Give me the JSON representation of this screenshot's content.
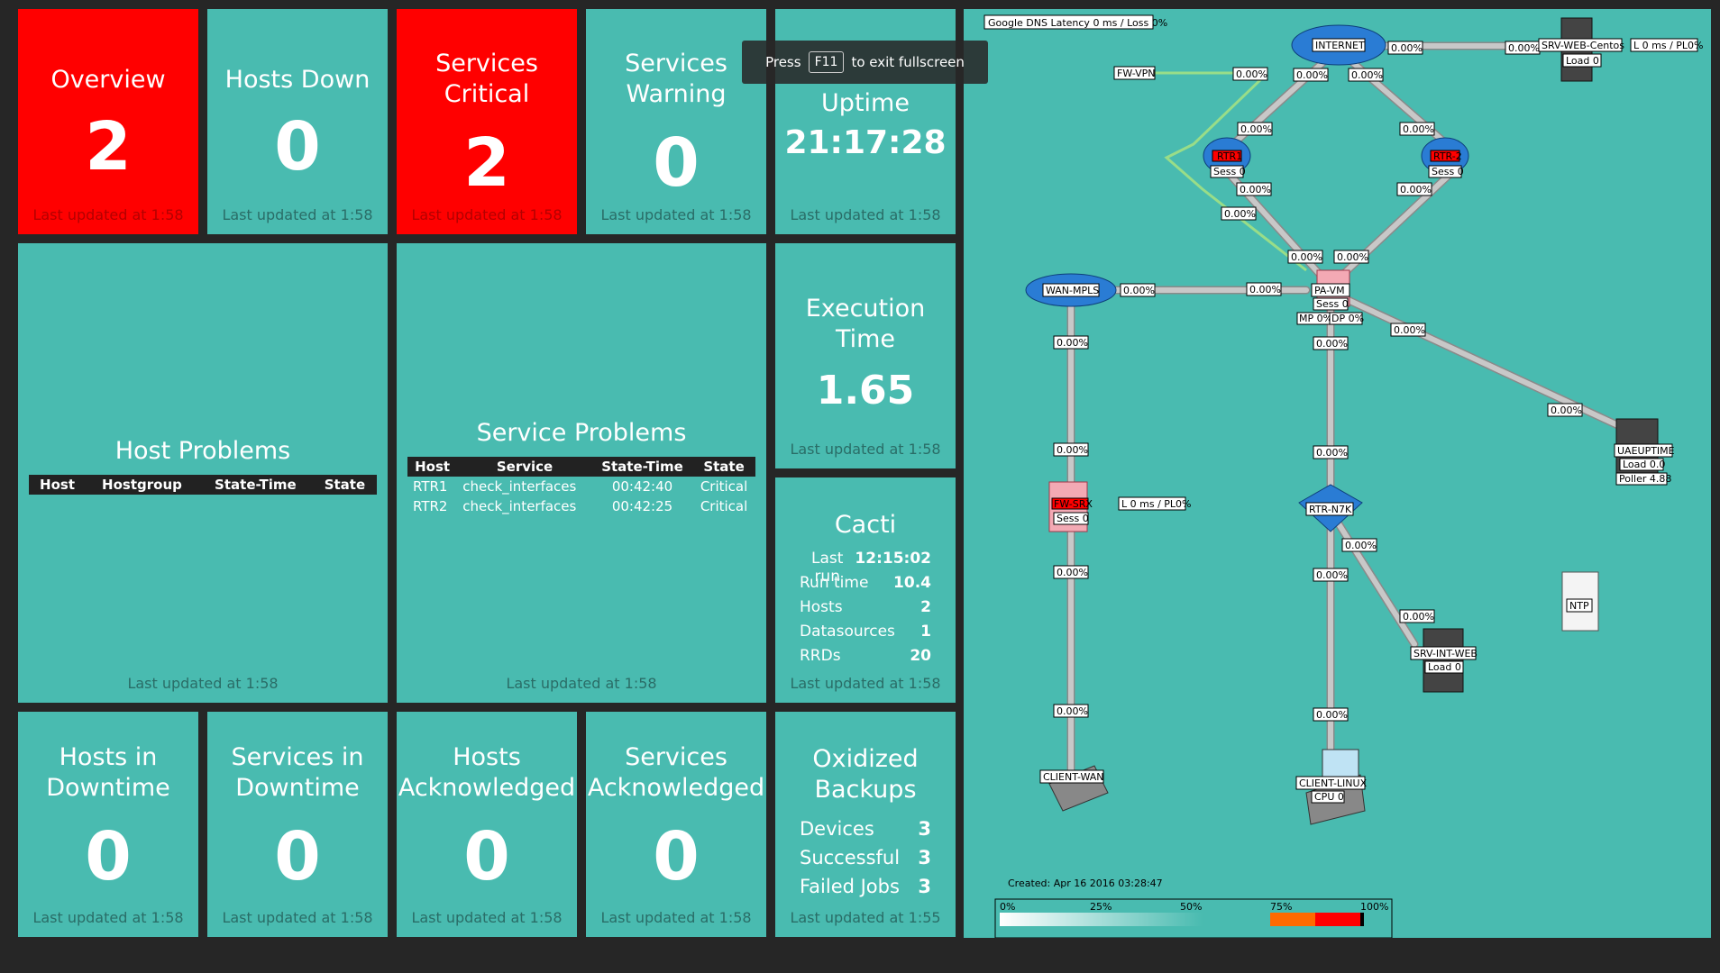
{
  "tiles": {
    "overview": {
      "title": "Overview",
      "value": "2",
      "footer": "Last updated at 1:58"
    },
    "hosts_down": {
      "title": "Hosts Down",
      "value": "0",
      "footer": "Last updated at 1:58"
    },
    "services_critical": {
      "title1": "Services",
      "title2": "Critical",
      "value": "2",
      "footer": "Last updated at 1:58"
    },
    "services_warning": {
      "title1": "Services",
      "title2": "Warning",
      "value": "0",
      "footer": "Last updated at 1:58"
    },
    "uptime": {
      "title": "Uptime",
      "value": "21:17:28",
      "footer": "Last updated at 1:58"
    },
    "host_problems": {
      "title": "Host Problems",
      "columns": [
        "Host",
        "Hostgroup",
        "State-Time",
        "State"
      ],
      "footer": "Last updated at 1:58"
    },
    "service_problems": {
      "title": "Service Problems",
      "columns": [
        "Host",
        "Service",
        "State-Time",
        "State"
      ],
      "rows": [
        [
          "RTR1",
          "check_interfaces",
          "00:42:40",
          "Critical"
        ],
        [
          "RTR2",
          "check_interfaces",
          "00:42:25",
          "Critical"
        ]
      ],
      "footer": "Last updated at 1:58"
    },
    "execution_time": {
      "title1": "Execution",
      "title2": "Time",
      "value": "1.65",
      "footer": "Last updated at 1:58"
    },
    "cacti": {
      "title": "Cacti",
      "items": [
        {
          "label": "Last run",
          "value": "12:15:02"
        },
        {
          "label": "Run time",
          "value": "10.4"
        },
        {
          "label": "Hosts",
          "value": "2"
        },
        {
          "label": "Datasources",
          "value": "1"
        },
        {
          "label": "RRDs",
          "value": "20"
        }
      ],
      "footer": "Last updated at 1:58"
    },
    "hosts_downtime": {
      "title1": "Hosts in",
      "title2": "Downtime",
      "value": "0",
      "footer": "Last updated at 1:58"
    },
    "services_downtime": {
      "title1": "Services in",
      "title2": "Downtime",
      "value": "0",
      "footer": "Last updated at 1:58"
    },
    "hosts_ack": {
      "title1": "Hosts",
      "title2": "Acknowledged",
      "value": "0",
      "footer": "Last updated at 1:58"
    },
    "services_ack": {
      "title1": "Services",
      "title2": "Acknowledged",
      "value": "0",
      "footer": "Last updated at 1:58"
    },
    "oxidized": {
      "title1": "Oxidized",
      "title2": "Backups",
      "items": [
        {
          "label": "Devices",
          "value": "3"
        },
        {
          "label": "Successful",
          "value": "3"
        },
        {
          "label": "Failed Jobs",
          "value": "3"
        }
      ],
      "footer": "Last updated at 1:55"
    }
  },
  "toast": {
    "press": "Press",
    "key": "F11",
    "rest": "to exit fullscreen"
  },
  "weathermap": {
    "header": "Google DNS Latency 0 ms / Loss 0%",
    "created": "Created: Apr 16 2016 03:28:47",
    "nodes": {
      "internet": "INTERNET",
      "srv_web_centos": "SRV-WEB-Centos",
      "srv_web_centos_load": "Load 0",
      "srv_web_centos_latency": "L 0 ms / PL0%",
      "fw_vpn": "FW-VPN",
      "rtr1": "RTR1",
      "rtr1_sess": "Sess 0",
      "rtr2": "RTR-2",
      "rtr2_sess": "Sess 0",
      "wan_mpls": "WAN-MPLS",
      "pa_vm": "PA-VM",
      "pa_vm_sess": "Sess 0",
      "pa_vm_mp": "MP 0%",
      "pa_vm_dp": "DP 0%",
      "uaeuptime": "UAEUPTIME",
      "uaeuptime_load": "Load 0.0",
      "uaeuptime_poller": "Poller 4.88",
      "fw_srx": "FW-SRX",
      "fw_srx_sess": "Sess 0",
      "fw_srx_latency": "L 0 ms / PL0%",
      "rtr_n7k": "RTR-N7K",
      "ntp": "NTP",
      "srv_int_web": "SRV-INT-WEB",
      "srv_int_web_load": "Load 0",
      "client_wan": "CLIENT-WAN",
      "client_linux": "CLIENT-LINUX",
      "client_linux_cpu": "CPU 0"
    },
    "link_pct": "0.00%",
    "legend": [
      "0%",
      "25%",
      "50%",
      "75%",
      "100%"
    ],
    "colors": {
      "bg": "#49bbb0",
      "link": "#c8c8c8",
      "vpn": "#99dd88",
      "critical": "#ff0000"
    }
  }
}
